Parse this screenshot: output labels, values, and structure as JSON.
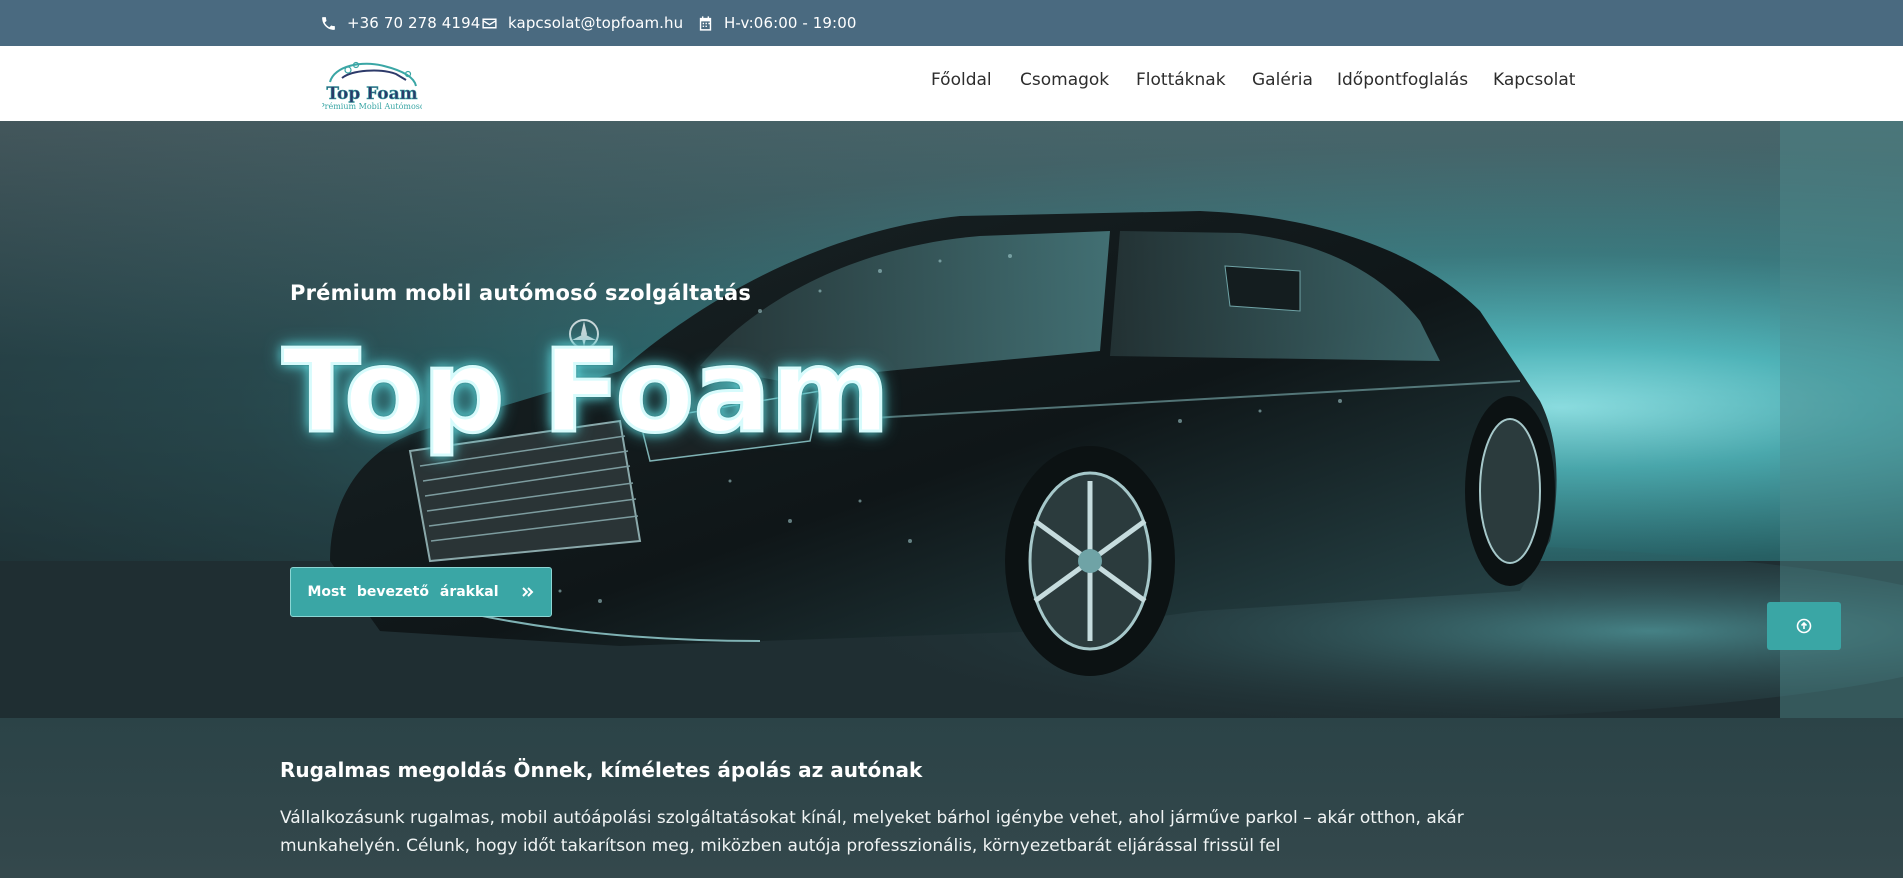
{
  "topbar": {
    "phone": "+36 70 278 4194",
    "email": "kapcsolat@topfoam.hu",
    "hours": "H-v:06:00 - 19:00",
    "icons": [
      "phone-icon",
      "envelope-icon",
      "calendar-icon"
    ]
  },
  "logo": {
    "name": "Top Foam",
    "tagline": "Prémium Mobil Autómosó"
  },
  "nav": {
    "items": [
      "Főoldal",
      "Csomagok",
      "Flottáknak",
      "Galéria",
      "Időpontfoglalás",
      "Kapcsolat"
    ]
  },
  "hero": {
    "subtitle": "Prémium mobil autómosó szolgáltatás",
    "title": "Top Foam",
    "cta_label": "Most bevezető árakkal",
    "cta_icon": "double-chevron-right-icon"
  },
  "scroll_top": {
    "icon": "arrow-up-circle-icon"
  },
  "info": {
    "heading": "Rugalmas megoldás Önnek, kíméletes ápolás az autónak",
    "text": "Vállalkozásunk rugalmas, mobil autóápolási szolgáltatásokat kínál, melyeket bárhol igénybe vehet, ahol járműve parkol – akár otthon, akár munkahelyén. Célunk, hogy időt takarítson meg, miközben autója professzionális, környezetbarát eljárással frissül fel"
  },
  "colors": {
    "topbar": "#4a6a80",
    "accent": "#3aa6a5",
    "nav_text": "#2d2d2d"
  }
}
